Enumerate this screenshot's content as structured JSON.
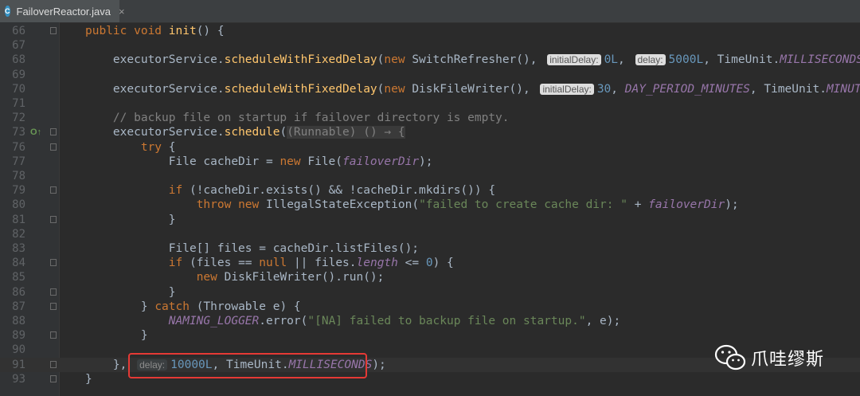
{
  "tab": {
    "filename": "FailoverReactor.java",
    "close_glyph": "×"
  },
  "watermark": {
    "text": "爪哇缪斯"
  },
  "lines": [
    {
      "n": "66",
      "fold": true,
      "segs": [
        {
          "t": "public void ",
          "c": "kw"
        },
        {
          "t": "init",
          "c": "fn"
        },
        {
          "t": "() {",
          "c": ""
        }
      ]
    },
    {
      "n": "67",
      "segs": []
    },
    {
      "n": "68",
      "segs": [
        {
          "t": "    executorService.",
          "c": ""
        },
        {
          "t": "scheduleWithFixedDelay",
          "c": "fn"
        },
        {
          "t": "(",
          "c": ""
        },
        {
          "t": "new ",
          "c": "kw"
        },
        {
          "t": "SwitchRefresher(), ",
          "c": ""
        },
        {
          "t": "initialDelay:",
          "c": "hint light"
        },
        {
          "t": "0L",
          "c": "num"
        },
        {
          "t": ", ",
          "c": ""
        },
        {
          "t": "delay:",
          "c": "hint light"
        },
        {
          "t": "5000L",
          "c": "num"
        },
        {
          "t": ", TimeUnit.",
          "c": ""
        },
        {
          "t": "MILLISECONDS",
          "c": "ital"
        },
        {
          "t": ");",
          "c": ""
        }
      ]
    },
    {
      "n": "69",
      "segs": []
    },
    {
      "n": "70",
      "segs": [
        {
          "t": "    executorService.",
          "c": ""
        },
        {
          "t": "scheduleWithFixedDelay",
          "c": "fn"
        },
        {
          "t": "(",
          "c": ""
        },
        {
          "t": "new ",
          "c": "kw"
        },
        {
          "t": "DiskFileWriter(), ",
          "c": ""
        },
        {
          "t": "initialDelay:",
          "c": "hint light"
        },
        {
          "t": "30",
          "c": "num"
        },
        {
          "t": ", ",
          "c": ""
        },
        {
          "t": "DAY_PERIOD_MINUTES",
          "c": "ital"
        },
        {
          "t": ", TimeUnit.",
          "c": ""
        },
        {
          "t": "MINUTES",
          "c": "ital"
        },
        {
          "t": ");",
          "c": ""
        }
      ]
    },
    {
      "n": "71",
      "segs": []
    },
    {
      "n": "72",
      "segs": [
        {
          "t": "    // backup file on startup if failover directory is empty.",
          "c": "com"
        }
      ]
    },
    {
      "n": "73",
      "impl": true,
      "fold": true,
      "segs": [
        {
          "t": "    executorService.",
          "c": ""
        },
        {
          "t": "schedule",
          "c": "fn"
        },
        {
          "t": "(",
          "c": ""
        },
        {
          "t": "(Runnable) () → {",
          "c": "lambda"
        }
      ]
    },
    {
      "n": "76",
      "fold": true,
      "segs": [
        {
          "t": "        ",
          "c": ""
        },
        {
          "t": "try ",
          "c": "kw"
        },
        {
          "t": "{",
          "c": ""
        }
      ]
    },
    {
      "n": "77",
      "segs": [
        {
          "t": "            File cacheDir = ",
          "c": ""
        },
        {
          "t": "new ",
          "c": "kw"
        },
        {
          "t": "File(",
          "c": ""
        },
        {
          "t": "failoverDir",
          "c": "ital"
        },
        {
          "t": ");",
          "c": ""
        }
      ]
    },
    {
      "n": "78",
      "segs": []
    },
    {
      "n": "79",
      "fold": true,
      "segs": [
        {
          "t": "            ",
          "c": ""
        },
        {
          "t": "if ",
          "c": "kw"
        },
        {
          "t": "(!cacheDir.exists() && !cacheDir.mkdirs()) {",
          "c": ""
        }
      ]
    },
    {
      "n": "80",
      "segs": [
        {
          "t": "                ",
          "c": ""
        },
        {
          "t": "throw new ",
          "c": "kw"
        },
        {
          "t": "IllegalStateException(",
          "c": ""
        },
        {
          "t": "\"failed to create cache dir: \"",
          "c": "str"
        },
        {
          "t": " + ",
          "c": ""
        },
        {
          "t": "failoverDir",
          "c": "ital"
        },
        {
          "t": ");",
          "c": ""
        }
      ]
    },
    {
      "n": "81",
      "fold": true,
      "segs": [
        {
          "t": "            }",
          "c": ""
        }
      ]
    },
    {
      "n": "82",
      "segs": []
    },
    {
      "n": "83",
      "segs": [
        {
          "t": "            File[] files = cacheDir.listFiles();",
          "c": ""
        }
      ]
    },
    {
      "n": "84",
      "fold": true,
      "segs": [
        {
          "t": "            ",
          "c": ""
        },
        {
          "t": "if ",
          "c": "kw"
        },
        {
          "t": "(files == ",
          "c": ""
        },
        {
          "t": "null ",
          "c": "kw"
        },
        {
          "t": "|| files.",
          "c": ""
        },
        {
          "t": "length ",
          "c": "ital"
        },
        {
          "t": "<= ",
          "c": ""
        },
        {
          "t": "0",
          "c": "num"
        },
        {
          "t": ") {",
          "c": ""
        }
      ]
    },
    {
      "n": "85",
      "segs": [
        {
          "t": "                ",
          "c": ""
        },
        {
          "t": "new ",
          "c": "kw"
        },
        {
          "t": "DiskFileWriter().run();",
          "c": ""
        }
      ]
    },
    {
      "n": "86",
      "fold": true,
      "segs": [
        {
          "t": "            }",
          "c": ""
        }
      ]
    },
    {
      "n": "87",
      "fold": true,
      "segs": [
        {
          "t": "        } ",
          "c": ""
        },
        {
          "t": "catch ",
          "c": "kw"
        },
        {
          "t": "(Throwable e) {",
          "c": ""
        }
      ]
    },
    {
      "n": "88",
      "segs": [
        {
          "t": "            ",
          "c": ""
        },
        {
          "t": "NAMING_LOGGER",
          "c": "ital"
        },
        {
          "t": ".error(",
          "c": ""
        },
        {
          "t": "\"[NA] failed to backup file on startup.\"",
          "c": "str"
        },
        {
          "t": ", e);",
          "c": ""
        }
      ]
    },
    {
      "n": "89",
      "fold": true,
      "segs": [
        {
          "t": "        }",
          "c": ""
        }
      ]
    },
    {
      "n": "90",
      "segs": []
    },
    {
      "n": "91",
      "current": true,
      "fold": true,
      "segs": [
        {
          "t": "    }, ",
          "c": ""
        },
        {
          "t": "delay:",
          "c": "hint"
        },
        {
          "t": "10000L",
          "c": "num"
        },
        {
          "t": ", TimeUnit.",
          "c": ""
        },
        {
          "t": "MILLISECONDS",
          "c": "ital"
        },
        {
          "t": ");",
          "c": ""
        }
      ]
    },
    {
      "n": "93",
      "fold": true,
      "segs": [
        {
          "t": "}",
          "c": ""
        }
      ]
    }
  ]
}
